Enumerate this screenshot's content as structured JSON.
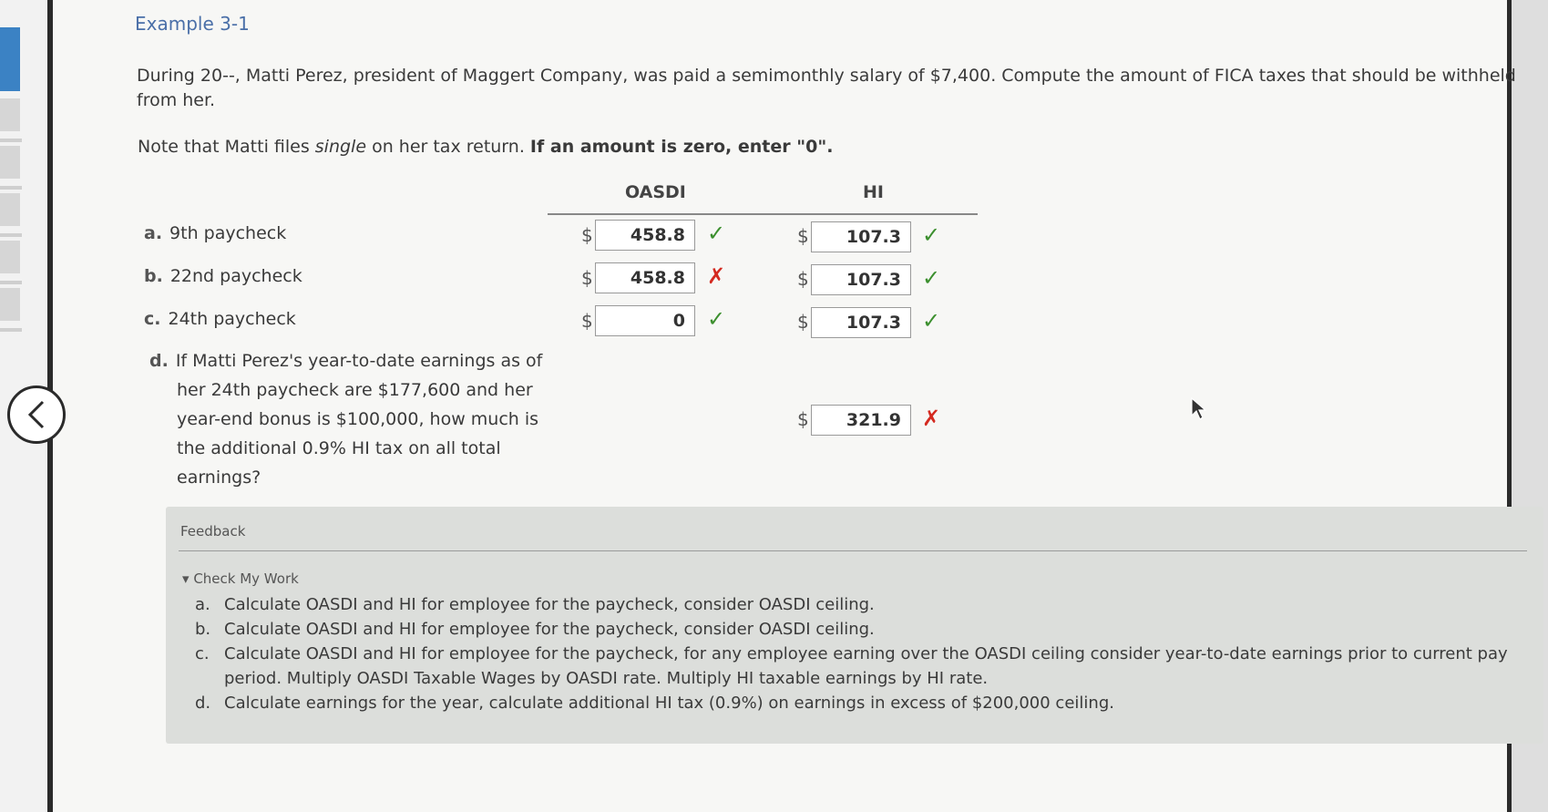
{
  "title": "Example 3-1",
  "problem_text": "During 20--, Matti Perez, president of Maggert Company, was paid a semimonthly salary of $7,400. Compute the amount of FICA taxes that should be withheld from her.",
  "note": {
    "prefix": "Note that Matti files ",
    "italic": "single",
    "middle": " on her tax return. ",
    "bold": "If an amount is zero, enter \"0\"."
  },
  "columns": {
    "oasdi": "OASDI",
    "hi": "HI"
  },
  "currency": "$",
  "questions": [
    {
      "letter": "a.",
      "label": "9th paycheck",
      "oasdi": "458.8",
      "oasdi_status": "correct",
      "hi": "107.3",
      "hi_status": "correct"
    },
    {
      "letter": "b.",
      "label": "22nd paycheck",
      "oasdi": "458.8",
      "oasdi_status": "incorrect",
      "hi": "107.3",
      "hi_status": "correct"
    },
    {
      "letter": "c.",
      "label": "24th paycheck",
      "oasdi": "0",
      "oasdi_status": "correct",
      "hi": "107.3",
      "hi_status": "correct"
    }
  ],
  "question_d": {
    "letter": "d.",
    "lines": [
      "If Matti Perez's year-to-date earnings as of",
      "her 24th paycheck are $177,600 and her",
      "year-end bonus is $100,000, how much is",
      "the additional 0.9% HI tax on all total",
      "earnings?"
    ],
    "answer": "321.9",
    "status": "incorrect"
  },
  "marks": {
    "correct": "✓",
    "incorrect": "✗"
  },
  "feedback": {
    "title": "Feedback",
    "toggle": "Check My Work",
    "items": [
      {
        "letter": "a.",
        "text": "Calculate OASDI and HI for employee for the paycheck, consider OASDI ceiling."
      },
      {
        "letter": "b.",
        "text": "Calculate OASDI and HI for employee for the paycheck, consider OASDI ceiling."
      },
      {
        "letter": "c.",
        "text": "Calculate OASDI and HI for employee for the paycheck, for any employee earning over the OASDI ceiling consider year-to-date earnings prior to current pay period. Multiply OASDI Taxable Wages by OASDI rate. Multiply HI taxable earnings by HI rate."
      },
      {
        "letter": "d.",
        "text": "Calculate earnings for the year, calculate additional HI tax (0.9%) on earnings in excess of $200,000 ceiling."
      }
    ]
  },
  "colors": {
    "correct": "#3c8f2e",
    "incorrect": "#d42a20",
    "title": "#4a6fa8"
  }
}
